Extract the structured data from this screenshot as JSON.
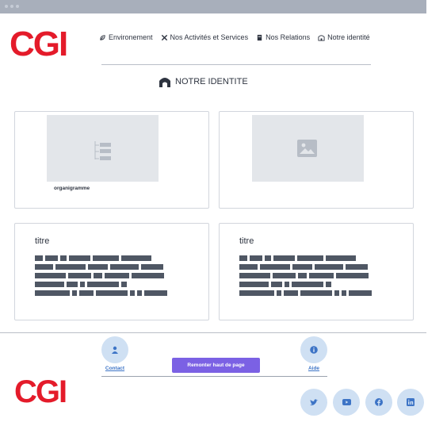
{
  "header": {
    "logo": "CGI",
    "nav": [
      {
        "label": "Environement",
        "icon": "leaf-icon"
      },
      {
        "label": "Nos Activités et Services",
        "icon": "tools-icon"
      },
      {
        "label": "Nos Relations",
        "icon": "book-icon"
      },
      {
        "label": "Notre identité",
        "icon": "building-icon"
      }
    ]
  },
  "main": {
    "section_title": "NOTRE IDENTITE",
    "section_icon": "arch-building-icon",
    "cards": [
      {
        "type": "image",
        "caption": "organigramme",
        "icon": "org-chart-icon"
      },
      {
        "type": "image",
        "caption": "",
        "icon": "image-icon"
      },
      {
        "type": "text",
        "title": "titre"
      },
      {
        "type": "text",
        "title": "titre"
      }
    ]
  },
  "footer": {
    "contact_label": "Contact",
    "help_label": "Aide",
    "back_to_top_label": "Remonter haut de page",
    "logo": "CGI",
    "social": [
      "twitter-icon",
      "youtube-icon",
      "facebook-icon",
      "linkedin-icon"
    ]
  },
  "colors": {
    "brand": "#e41b2a",
    "accent": "#7b61e4",
    "link": "#3d74c6",
    "icon_circle": "#cfe0f3",
    "text_bars": "#4f5764"
  }
}
